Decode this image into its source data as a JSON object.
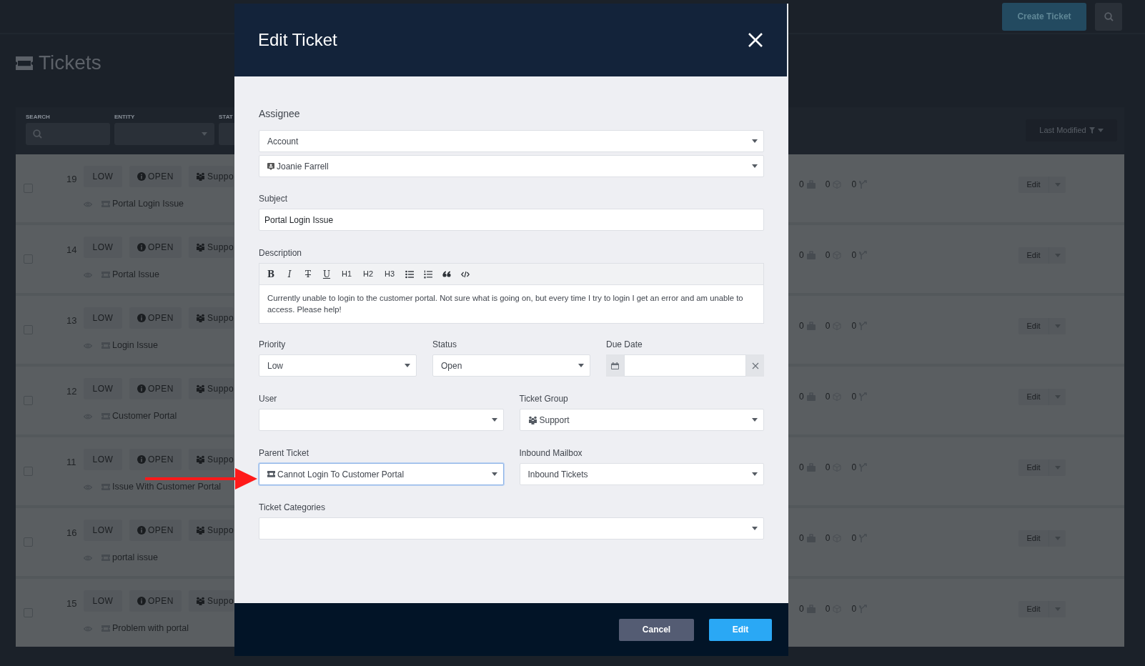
{
  "topbar": {
    "create_button": "Create Ticket"
  },
  "page_title": "Tickets",
  "filters": [
    {
      "label": "SEARCH",
      "kind": "search"
    },
    {
      "label": "ENTITY",
      "kind": "select"
    },
    {
      "label": "STAT",
      "kind": "cut"
    }
  ],
  "sort": {
    "label": "Last Modified"
  },
  "tickets": [
    {
      "number": "19",
      "priority": "LOW",
      "status": "OPEN",
      "group": "Suppo",
      "title": "Portal Login Issue",
      "counts": [
        "0",
        "0",
        "0"
      ],
      "action": "Edit",
      "checked": false
    },
    {
      "number": "14",
      "priority": "LOW",
      "status": "OPEN",
      "group": "Suppo",
      "title": "Portal Issue",
      "counts": [
        "0",
        "0",
        "0"
      ],
      "action": "Edit",
      "checked": false
    },
    {
      "number": "13",
      "priority": "LOW",
      "status": "OPEN",
      "group": "Suppo",
      "title": "Login Issue",
      "counts": [
        "0",
        "0",
        "0"
      ],
      "action": "Edit",
      "checked": false
    },
    {
      "number": "12",
      "priority": "LOW",
      "status": "OPEN",
      "group": "Suppo",
      "title": "Customer Portal",
      "counts": [
        "0",
        "0",
        "0"
      ],
      "action": "Edit",
      "checked": false
    },
    {
      "number": "11",
      "priority": "LOW",
      "status": "OPEN",
      "group": "Suppo",
      "title": "Issue With Customer Portal",
      "counts": [
        "0",
        "0",
        "0"
      ],
      "action": "Edit",
      "checked": false
    },
    {
      "number": "16",
      "priority": "LOW",
      "status": "OPEN",
      "group": "Suppo",
      "title": "portal issue",
      "counts": [
        "0",
        "0",
        "0"
      ],
      "action": "Edit",
      "checked": false
    },
    {
      "number": "15",
      "priority": "LOW",
      "status": "OPEN",
      "group": "Suppo",
      "title": "Problem with portal",
      "counts": [
        "0",
        "0",
        "0"
      ],
      "action": "Edit",
      "checked": false
    }
  ],
  "modal": {
    "title": "Edit Ticket",
    "assignee": {
      "label": "Assignee",
      "type": "Account",
      "value": "Joanie Farrell"
    },
    "subject": {
      "label": "Subject",
      "value": "Portal Login Issue"
    },
    "description": {
      "label": "Description",
      "toolbar": [
        {
          "kind": "bold",
          "label": "B"
        },
        {
          "kind": "italic",
          "label": "I"
        },
        {
          "kind": "strike",
          "label": "T"
        },
        {
          "kind": "underline",
          "label": "U"
        },
        {
          "kind": "text",
          "label": "H1"
        },
        {
          "kind": "text",
          "label": "H2"
        },
        {
          "kind": "text",
          "label": "H3"
        },
        {
          "kind": "bullet-list"
        },
        {
          "kind": "numbered-list"
        },
        {
          "kind": "quote"
        },
        {
          "kind": "code"
        }
      ],
      "text": "Currently unable to login to the customer portal. Not sure what is going on, but every time I try to login I get an error and am unable to access. Please help!"
    },
    "field_rows": [
      [
        {
          "label": "Priority",
          "value": "Low",
          "kind": "select",
          "focused": false
        },
        {
          "label": "Status",
          "value": "Open",
          "kind": "select",
          "focused": false
        },
        {
          "label": "Due Date",
          "kind": "date",
          "focused": false
        }
      ],
      [
        {
          "label": "User",
          "kind": "select",
          "focused": false
        },
        {
          "label": "Ticket Group",
          "value": "Support",
          "kind": "group-select",
          "focused": false
        }
      ],
      [
        {
          "label": "Parent Ticket",
          "value": "Cannot Login To Customer Portal",
          "kind": "ticket-select",
          "focused": true
        },
        {
          "label": "Inbound Mailbox",
          "value": "Inbound Tickets",
          "kind": "select",
          "focused": false
        }
      ],
      [
        {
          "label": "Ticket Categories",
          "kind": "select",
          "focused": false
        }
      ]
    ],
    "buttons": [
      {
        "label": "Cancel",
        "kind": "secondary"
      },
      {
        "label": "Edit",
        "kind": "primary"
      }
    ]
  }
}
